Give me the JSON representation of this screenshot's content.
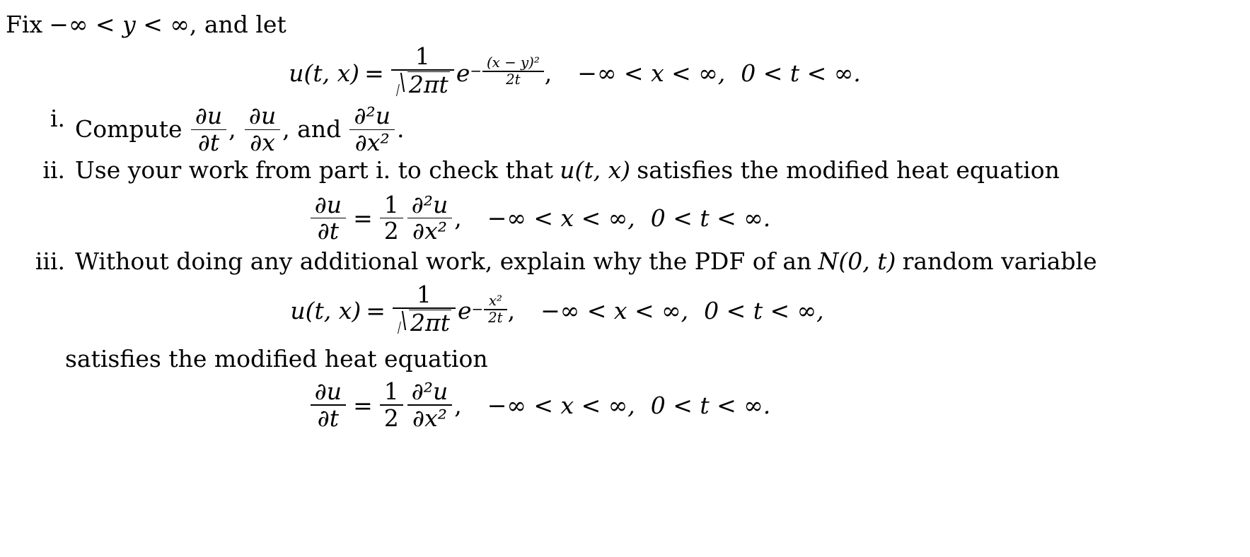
{
  "document": {
    "intro": {
      "prefix": "Fix",
      "range": "−∞ < y < ∞",
      "suffix": ", and let"
    },
    "symbols": {
      "u": "u",
      "t": "t",
      "x": "x",
      "y": "y",
      "e": "e",
      "n": "N",
      "pi": "π",
      "partial": "∂",
      "infty": "∞",
      "neg_infty": "−∞",
      "equals": "=",
      "less": "<",
      "comma": ",",
      "period": ".",
      "two": "2",
      "one": "1",
      "zero": "0"
    },
    "equation_1": {
      "lhs": "u(t, x)",
      "relation": "=",
      "numerator": "1",
      "denominator_radicand": "2πt",
      "exp_base": "e",
      "exp_sign": "−",
      "exp_numerator": "(x − y)²",
      "exp_denominator": "2t",
      "trailing_comma": ",",
      "condition_x": "−∞ < x < ∞,",
      "condition_t": "0 < t < ∞.",
      "latex": "u(t,x) = \\frac{1}{\\sqrt{2\\pi t}} e^{-\\frac{(x-y)^2}{2t}},\\quad -\\infty < x < \\infty,\\quad 0 < t < \\infty."
    },
    "items": [
      {
        "label": "i.",
        "text_before": "Compute",
        "derivative_1_num": "∂u",
        "derivative_1_den": "∂t",
        "sep_1": ",",
        "derivative_2_num": "∂u",
        "derivative_2_den": "∂x",
        "sep_2": ", and",
        "derivative_3_num": "∂²u",
        "derivative_3_den": "∂x²",
        "text_after": ".",
        "latex": "Compute \\frac{\\partial u}{\\partial t}, \\frac{\\partial u}{\\partial x}, and \\frac{\\partial^2 u}{\\partial x^2}."
      },
      {
        "label": "ii.",
        "text_before": "Use your work from part i. to check that",
        "inline_math": "u(t, x)",
        "text_after": "satisfies the modified heat equation"
      },
      {
        "label": "iii.",
        "text_before": "Without doing any additional work, explain why the PDF of an",
        "inline_math": "N(0, t)",
        "text_after": "random variable"
      }
    ],
    "equation_2": {
      "lhs_num": "∂u",
      "lhs_den": "∂t",
      "relation": "=",
      "coefficient_num": "1",
      "coefficient_den": "2",
      "rhs_num": "∂²u",
      "rhs_den": "∂x²",
      "trailing_comma": ",",
      "condition_x": "−∞ < x < ∞,",
      "condition_t": "0 < t < ∞.",
      "latex": "\\frac{\\partial u}{\\partial t} = \\frac{1}{2}\\frac{\\partial^2 u}{\\partial x^2},\\quad -\\infty < x < \\infty,\\quad 0 < t < \\infty."
    },
    "equation_3": {
      "lhs": "u(t, x)",
      "relation": "=",
      "numerator": "1",
      "denominator_radicand": "2πt",
      "exp_base": "e",
      "exp_sign": "−",
      "exp_numerator": "x²",
      "exp_denominator": "2t",
      "trailing_comma": ",",
      "condition_x": "−∞ < x < ∞,",
      "condition_t": "0 < t < ∞,",
      "latex": "u(t,x) = \\frac{1}{\\sqrt{2\\pi t}} e^{-\\frac{x^2}{2t}},\\quad -\\infty < x < \\infty,\\quad 0 < t < \\infty,"
    },
    "closing_text": "satisfies the modified heat equation",
    "equation_4": {
      "lhs_num": "∂u",
      "lhs_den": "∂t",
      "relation": "=",
      "coefficient_num": "1",
      "coefficient_den": "2",
      "rhs_num": "∂²u",
      "rhs_den": "∂x²",
      "trailing_comma": ",",
      "condition_x": "−∞ < x < ∞,",
      "condition_t": "0 < t < ∞.",
      "latex": "\\frac{\\partial u}{\\partial t} = \\frac{1}{2}\\frac{\\partial^2 u}{\\partial x^2},\\quad -\\infty < x < \\infty,\\quad 0 < t < \\infty."
    },
    "colors": {
      "text": "#000000",
      "background": "#ffffff"
    }
  }
}
